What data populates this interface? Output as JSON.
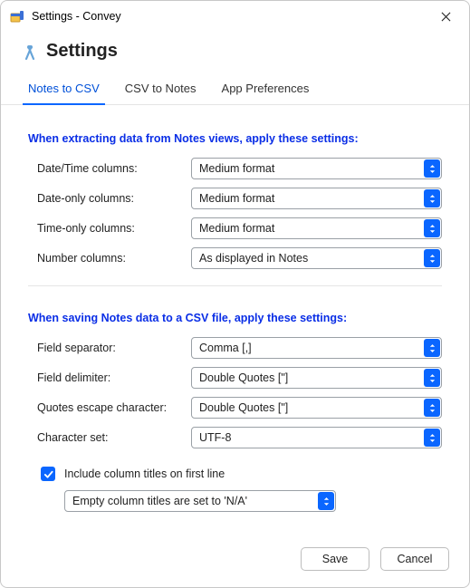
{
  "window": {
    "title": "Settings - Convey"
  },
  "heading": "Settings",
  "tabs": [
    {
      "label": "Notes to CSV",
      "active": true
    },
    {
      "label": "CSV to Notes",
      "active": false
    },
    {
      "label": "App Preferences",
      "active": false
    }
  ],
  "sections": {
    "extract": {
      "title": "When extracting data from Notes views, apply these settings:",
      "rows": {
        "datetime": {
          "label": "Date/Time columns:",
          "value": "Medium format"
        },
        "dateonly": {
          "label": "Date-only columns:",
          "value": "Medium format"
        },
        "timeonly": {
          "label": "Time-only columns:",
          "value": "Medium format"
        },
        "number": {
          "label": "Number columns:",
          "value": "As displayed in Notes"
        }
      }
    },
    "save": {
      "title": "When saving Notes data to a CSV file, apply these settings:",
      "rows": {
        "separator": {
          "label": "Field separator:",
          "value": "Comma [,]"
        },
        "delimiter": {
          "label": "Field delimiter:",
          "value": "Double Quotes [\"]"
        },
        "escape": {
          "label": "Quotes escape character:",
          "value": "Double Quotes [\"]"
        },
        "charset": {
          "label": "Character set:",
          "value": "UTF-8"
        }
      }
    },
    "footer_opts": {
      "include_titles": {
        "checked": true,
        "label": "Include column titles on first line"
      },
      "empty_titles": {
        "value": "Empty column titles are set to 'N/A'"
      }
    }
  },
  "buttons": {
    "save": "Save",
    "cancel": "Cancel"
  }
}
